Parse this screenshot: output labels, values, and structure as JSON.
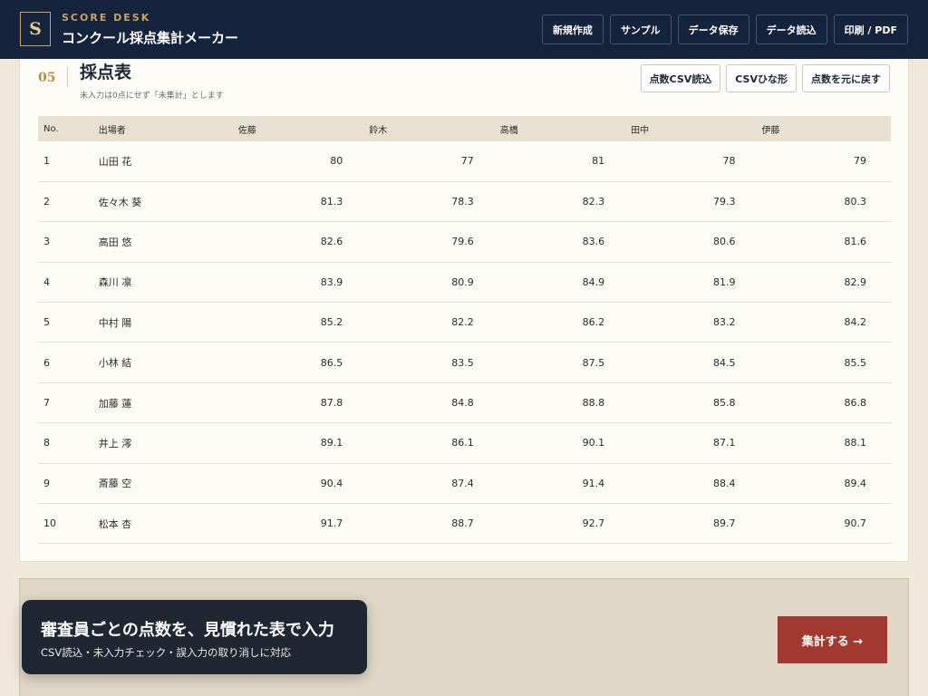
{
  "header": {
    "logo_letter": "S",
    "brand_sub": "SCORE DESK",
    "brand_title": "コンクール採点集計メーカー",
    "actions": [
      "新規作成",
      "サンプル",
      "データ保存",
      "データ読込",
      "印刷 / PDF"
    ]
  },
  "section": {
    "number": "05",
    "title": "採点表",
    "note": "未入力は0点にせず「未集計」とします",
    "actions": [
      "点数CSV読込",
      "CSVひな形",
      "点数を元に戻す"
    ]
  },
  "table": {
    "headers": [
      "No.",
      "出場者",
      "佐藤",
      "鈴木",
      "高橋",
      "田中",
      "伊藤"
    ],
    "rows": [
      {
        "no": "1",
        "name": "山田 花",
        "scores": [
          "80",
          "77",
          "81",
          "78",
          "79"
        ]
      },
      {
        "no": "2",
        "name": "佐々木 葵",
        "scores": [
          "81.3",
          "78.3",
          "82.3",
          "79.3",
          "80.3"
        ]
      },
      {
        "no": "3",
        "name": "高田 悠",
        "scores": [
          "82.6",
          "79.6",
          "83.6",
          "80.6",
          "81.6"
        ]
      },
      {
        "no": "4",
        "name": "森川 凛",
        "scores": [
          "83.9",
          "80.9",
          "84.9",
          "81.9",
          "82.9"
        ]
      },
      {
        "no": "5",
        "name": "中村 陽",
        "scores": [
          "85.2",
          "82.2",
          "86.2",
          "83.2",
          "84.2"
        ]
      },
      {
        "no": "6",
        "name": "小林 結",
        "scores": [
          "86.5",
          "83.5",
          "87.5",
          "84.5",
          "85.5"
        ]
      },
      {
        "no": "7",
        "name": "加藤 蓮",
        "scores": [
          "87.8",
          "84.8",
          "88.8",
          "85.8",
          "86.8"
        ]
      },
      {
        "no": "8",
        "name": "井上 澪",
        "scores": [
          "89.1",
          "86.1",
          "90.1",
          "87.1",
          "88.1"
        ]
      },
      {
        "no": "9",
        "name": "斎藤 空",
        "scores": [
          "90.4",
          "87.4",
          "91.4",
          "88.4",
          "89.4"
        ]
      },
      {
        "no": "10",
        "name": "松本 杏",
        "scores": [
          "91.7",
          "88.7",
          "92.7",
          "89.7",
          "90.7"
        ]
      }
    ]
  },
  "footer": {
    "submit_label": "集計する →"
  },
  "toast": {
    "title": "審査員ごとの点数を、見慣れた表で入力",
    "subtitle": "CSV読込・未入力チェック・誤入力の取り消しに対応"
  }
}
